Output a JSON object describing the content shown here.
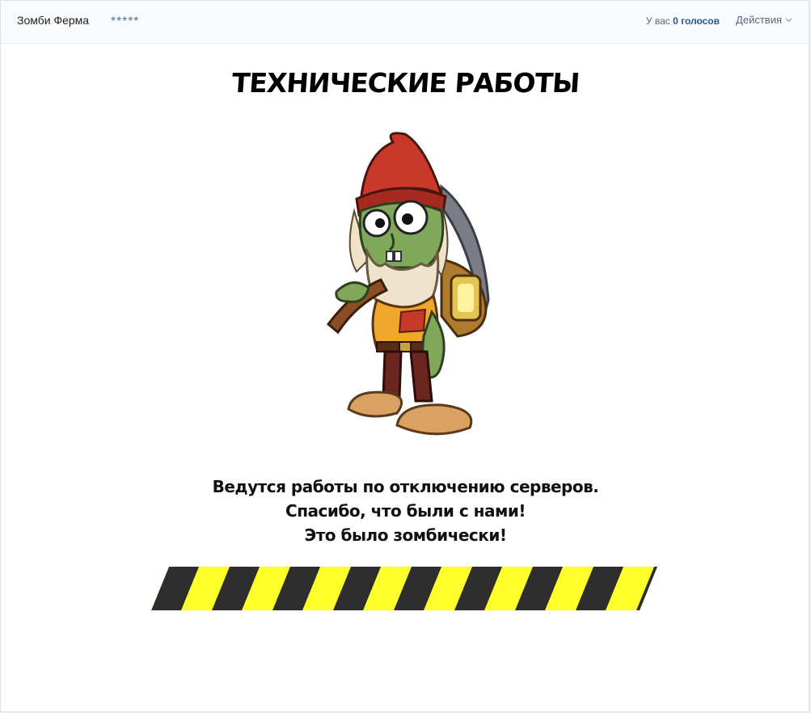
{
  "header": {
    "app_title": "Зомби Ферма",
    "rating_stars": "★★★★★",
    "votes_prefix": "У вас ",
    "votes_count": "0 голосов",
    "actions_label": "Действия"
  },
  "main": {
    "headline": "ТЕХНИЧЕСКИЕ РАБОТЫ",
    "message_lines": [
      "Ведутся работы по отключению серверов.",
      "Спасибо, что были с нами!",
      "Это было зомбически!"
    ]
  },
  "colors": {
    "stripe_dark": "#2e2e2e",
    "stripe_yellow": "#ffff2b",
    "link": "#2a5885"
  },
  "icons": {
    "actions_chevron": "chevron-down-icon",
    "character": "zombie-gnome-illustration"
  }
}
